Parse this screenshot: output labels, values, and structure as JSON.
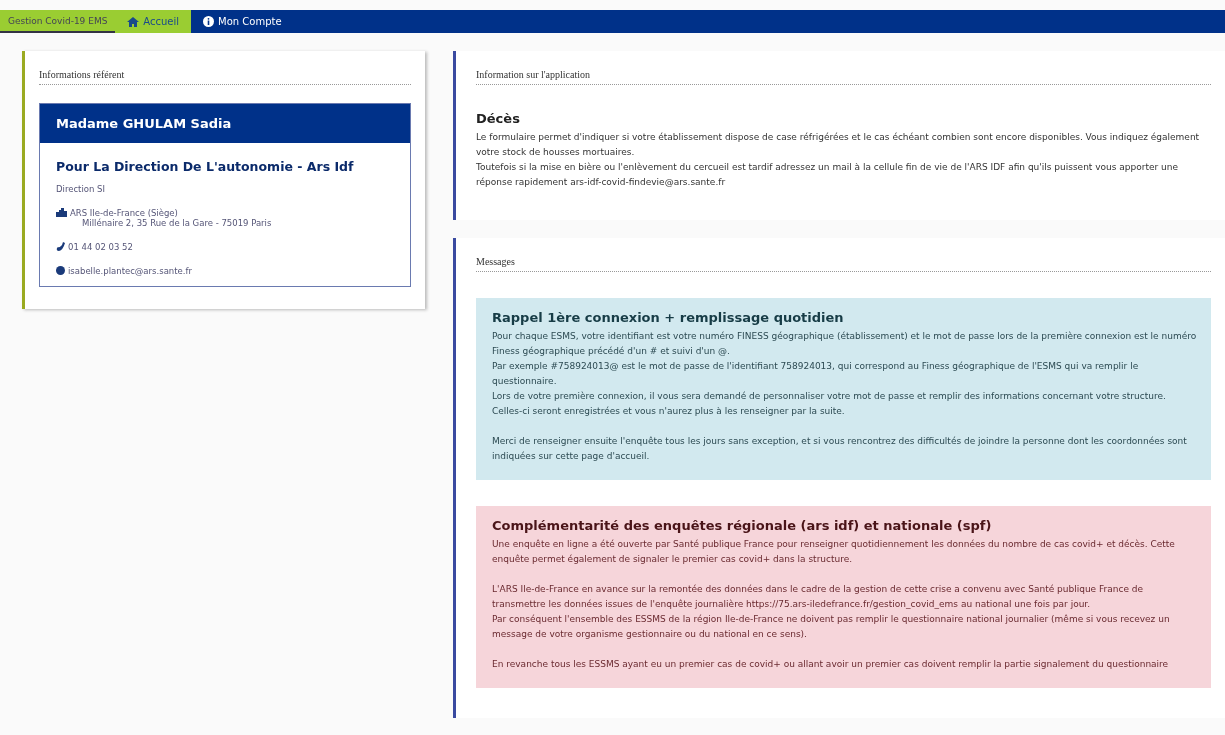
{
  "navbar": {
    "brand": "Gestion Covid-19 EMS",
    "items": [
      {
        "label": "Accueil",
        "kind": "home",
        "selected": true
      },
      {
        "label": "Mon Compte",
        "kind": "info",
        "selected": false
      }
    ]
  },
  "referent": {
    "title": "Informations référent",
    "name": "Madame GHULAM Sadia",
    "organisation": "Pour La Direction De L'autonomie - Ars Idf",
    "service": "Direction SI",
    "address_name": "ARS Ile-de-France (Siège)",
    "address": "Millénaire 2, 35 Rue de la Gare - 75019 Paris",
    "phone": "01 44 02 03 52",
    "email": "isabelle.plantec@ars.sante.fr"
  },
  "info": {
    "title": "Information sur l'application",
    "heading": "Décès",
    "paragraphs": [
      "Le formulaire permet d'indiquer si votre établissement dispose de case réfrigérées et le cas échéant combien sont encore disponibles. Vous indiquez également votre stock de housses mortuaires.",
      "Toutefois si la mise en bière ou l'enlèvement du cercueil est tardif adressez un mail à la cellule fin de vie de l'ARS IDF afin qu'ils puissent vous apporter une réponse rapidement ars-idf-covid-findevie@ars.sante.fr"
    ]
  },
  "messages": {
    "title": "Messages",
    "items": [
      {
        "kind": "info",
        "title": "Rappel 1ère connexion + remplissage quotidien",
        "blocks": [
          [
            "Pour chaque ESMS, votre identifiant est votre numéro FINESS géographique (établissement) et le mot de passe lors de la première connexion est le numéro Finess géographique précédé d'un # et suivi d'un @.",
            "Par exemple #758924013@ est le mot de passe de l'identifiant 758924013, qui correspond au Finess géographique de l'ESMS qui va remplir le questionnaire.",
            "Lors de votre première connexion, il vous sera demandé de personnaliser votre mot de passe et remplir des informations concernant votre structure. Celles-ci seront enregistrées et vous n'aurez plus à les renseigner par la suite."
          ],
          [
            "Merci de renseigner ensuite l'enquête tous les jours sans exception, et si vous rencontrez des difficultés de joindre la personne dont les coordonnées sont indiquées sur cette page d'accueil."
          ]
        ]
      },
      {
        "kind": "danger",
        "title": "Complémentarité des enquêtes régionale (ars idf) et nationale (spf)",
        "blocks": [
          [
            "Une enquête en ligne a été ouverte par Santé publique France pour renseigner quotidiennement les données du nombre de cas covid+ et décès. Cette enquête permet également de signaler le premier cas covid+ dans la structure."
          ],
          [
            "L'ARS Ile-de-France en avance sur la remontée des données dans le cadre de la gestion de cette crise a convenu avec Santé publique France de transmettre les données issues de l'enquête journalière https://75.ars-iledefrance.fr/gestion_covid_ems au national une fois par jour.",
            "Par conséquent l'ensemble des ESSMS de la région Ile-de-France ne doivent pas remplir le questionnaire national journalier (même si vous recevez un message de votre organisme gestionnaire ou du national en ce sens)."
          ],
          [
            "En revanche tous les ESSMS ayant eu un premier cas de covid+ ou allant avoir un premier cas doivent remplir la partie signalement du questionnaire"
          ]
        ]
      }
    ]
  }
}
